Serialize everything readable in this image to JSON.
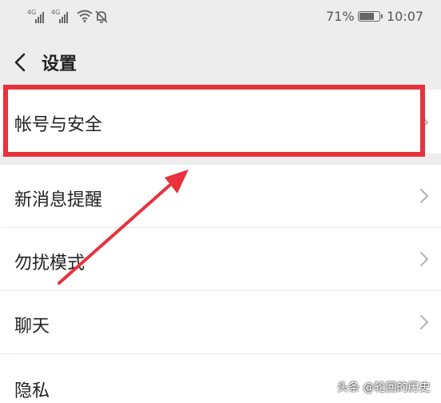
{
  "status_bar": {
    "signal1_label": "4G",
    "signal2_label": "4G",
    "battery_percent": "71%",
    "battery_level": 0.71,
    "time": "10:07",
    "icons": [
      "signal-icon",
      "signal-icon",
      "wifi-icon",
      "bell-off-icon",
      "battery-icon"
    ]
  },
  "header": {
    "back_icon": "chevron-left-icon",
    "title": "设置"
  },
  "settings": {
    "items": [
      {
        "label": "帐号与安全"
      },
      {
        "label": "新消息提醒"
      },
      {
        "label": "勿扰模式"
      },
      {
        "label": "聊天"
      },
      {
        "label": "隐私"
      }
    ]
  },
  "annotation": {
    "highlight_color": "#e8323c",
    "arrow_color": "#e8323c"
  },
  "watermark": {
    "text": "头条 @轮回的历史"
  }
}
